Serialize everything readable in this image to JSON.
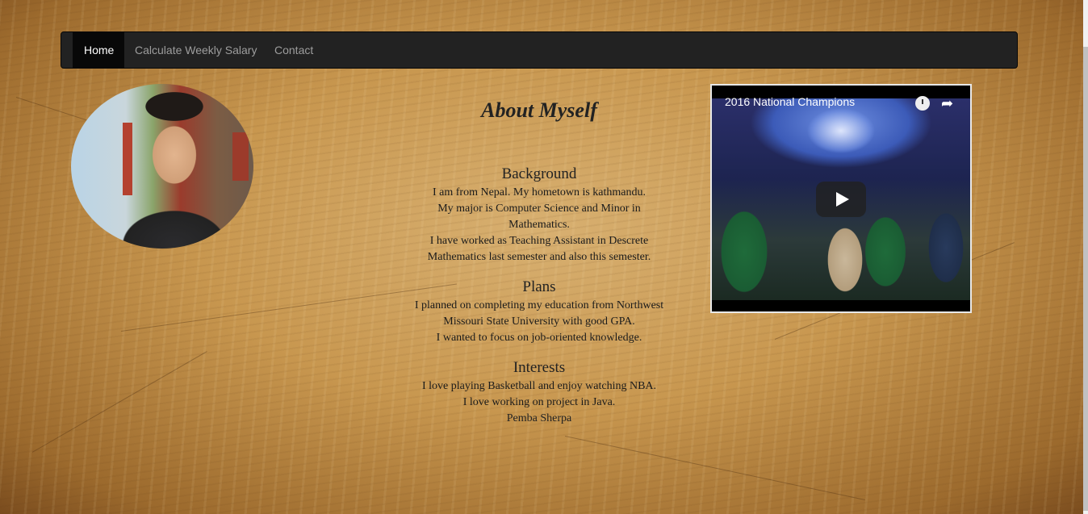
{
  "nav": {
    "items": [
      {
        "label": "Home",
        "active": true
      },
      {
        "label": "Calculate Weekly Salary",
        "active": false
      },
      {
        "label": "Contact",
        "active": false
      }
    ]
  },
  "profile": {
    "photo_icon": "person-photo"
  },
  "about": {
    "title": "About Myself",
    "sections": [
      {
        "heading": "Background",
        "lines": [
          "I am from Nepal. My hometown is kathmandu.",
          "My major is Computer Science and Minor in Mathematics.",
          "I have worked as Teaching Assistant in Descrete Mathematics last semester and also this semester."
        ]
      },
      {
        "heading": "Plans",
        "lines": [
          "I planned on completing my education from Northwest Missouri State University with good GPA.",
          "I wanted to focus on job-oriented knowledge."
        ]
      },
      {
        "heading": "Interests",
        "lines": [
          "I love playing Basketball and enjoy watching NBA.",
          "I love working on project in Java."
        ]
      }
    ],
    "author": "Pemba Sherpa"
  },
  "video": {
    "title": "2016 National Champions",
    "icons": [
      "watch-later-icon",
      "share-icon",
      "play-icon"
    ]
  },
  "colors": {
    "navbar": "#222222",
    "nav_active": "#080808",
    "nav_text": "#9d9d9d",
    "text": "#1b1b1b"
  }
}
